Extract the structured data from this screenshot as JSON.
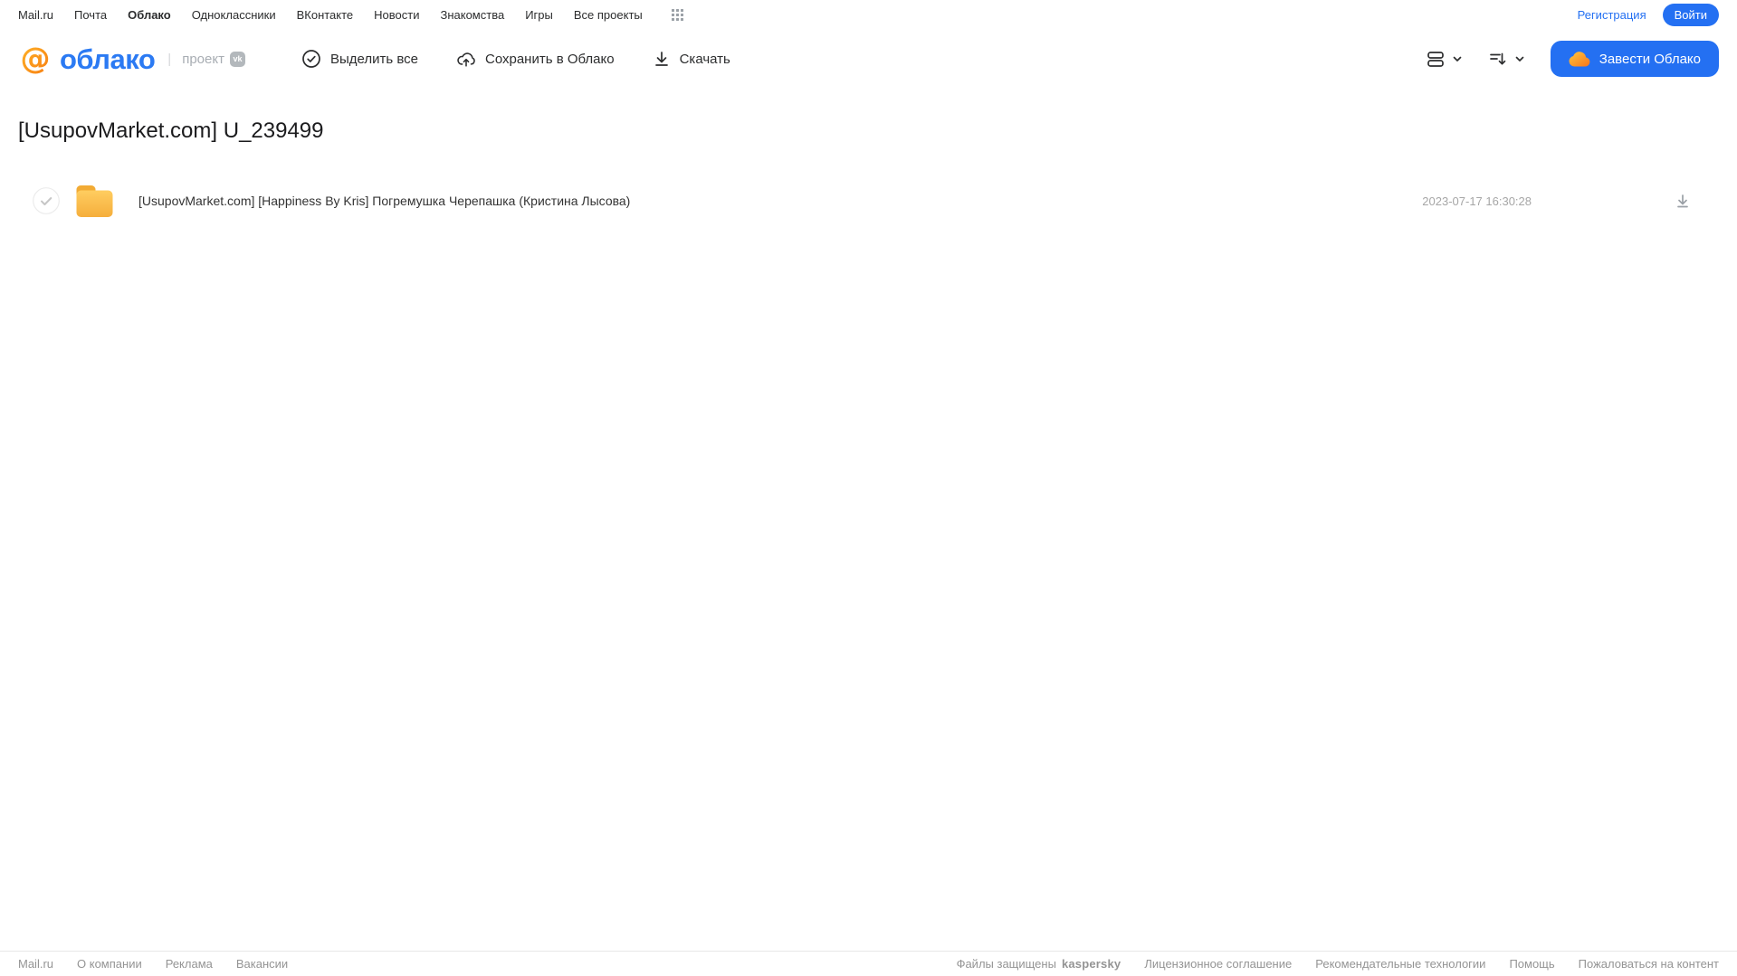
{
  "topnav": {
    "links": [
      {
        "label": "Mail.ru",
        "active": false
      },
      {
        "label": "Почта",
        "active": false
      },
      {
        "label": "Облако",
        "active": true
      },
      {
        "label": "Одноклассники",
        "active": false
      },
      {
        "label": "ВКонтакте",
        "active": false
      },
      {
        "label": "Новости",
        "active": false
      },
      {
        "label": "Знакомства",
        "active": false
      },
      {
        "label": "Игры",
        "active": false
      },
      {
        "label": "Все проекты",
        "active": false
      }
    ],
    "register_label": "Регистрация",
    "login_label": "Войти"
  },
  "header": {
    "logo_at": "@",
    "logo_word": "облако",
    "project_separator": "|",
    "project_label": "проект",
    "vk_badge": "vk",
    "toolbar": [
      {
        "icon": "check-circle-icon",
        "label": "Выделить все"
      },
      {
        "icon": "cloud-upload-icon",
        "label": "Сохранить в Облако"
      },
      {
        "icon": "download-icon",
        "label": "Скачать"
      }
    ],
    "create_cloud_label": "Завести Облако"
  },
  "page": {
    "title": "[UsupovMarket.com] U_239499"
  },
  "files": [
    {
      "type": "folder",
      "name": "[UsupovMarket.com] [Happiness By Kris] Погремушка Черепашка (Кристина Лысова)",
      "modified": "2023-07-17 16:30:28"
    }
  ],
  "footer": {
    "left_links": [
      {
        "label": "Mail.ru"
      },
      {
        "label": "О компании"
      },
      {
        "label": "Реклама"
      },
      {
        "label": "Вакансии"
      }
    ],
    "protected_prefix": "Файлы защищены",
    "kaspersky_brand": "kaspersky",
    "right_links": [
      {
        "label": "Лицензионное соглашение"
      },
      {
        "label": "Рекомендательные технологии"
      },
      {
        "label": "Помощь"
      },
      {
        "label": "Пожаловаться на контент"
      }
    ]
  },
  "icons": {
    "apps-grid-icon": "3x3 dots grid",
    "at-logo-icon": "orange @ mail.ru mark",
    "vk-badge-icon": "gray vk rounded square",
    "check-circle-icon": "circle with check",
    "cloud-upload-icon": "cloud with up arrow",
    "download-icon": "down arrow with base line",
    "view-toggle-icon": "two stacked rounded rectangles",
    "sort-icon": "lines with down arrow",
    "chevron-down-icon": "small chevron down",
    "cloud-orange-icon": "orange cloud",
    "checkbox-circle-icon": "light circle with gray check",
    "folder-icon": "yellow folder"
  },
  "colors": {
    "accent_blue": "#2470f2",
    "logo_blue": "#2b7af3",
    "logo_orange": "#ff9500",
    "folder_yellow": "#f9be4b",
    "kaspersky_teal": "#00a88e",
    "muted_gray": "#a6a6a6",
    "footer_gray": "#949494"
  }
}
